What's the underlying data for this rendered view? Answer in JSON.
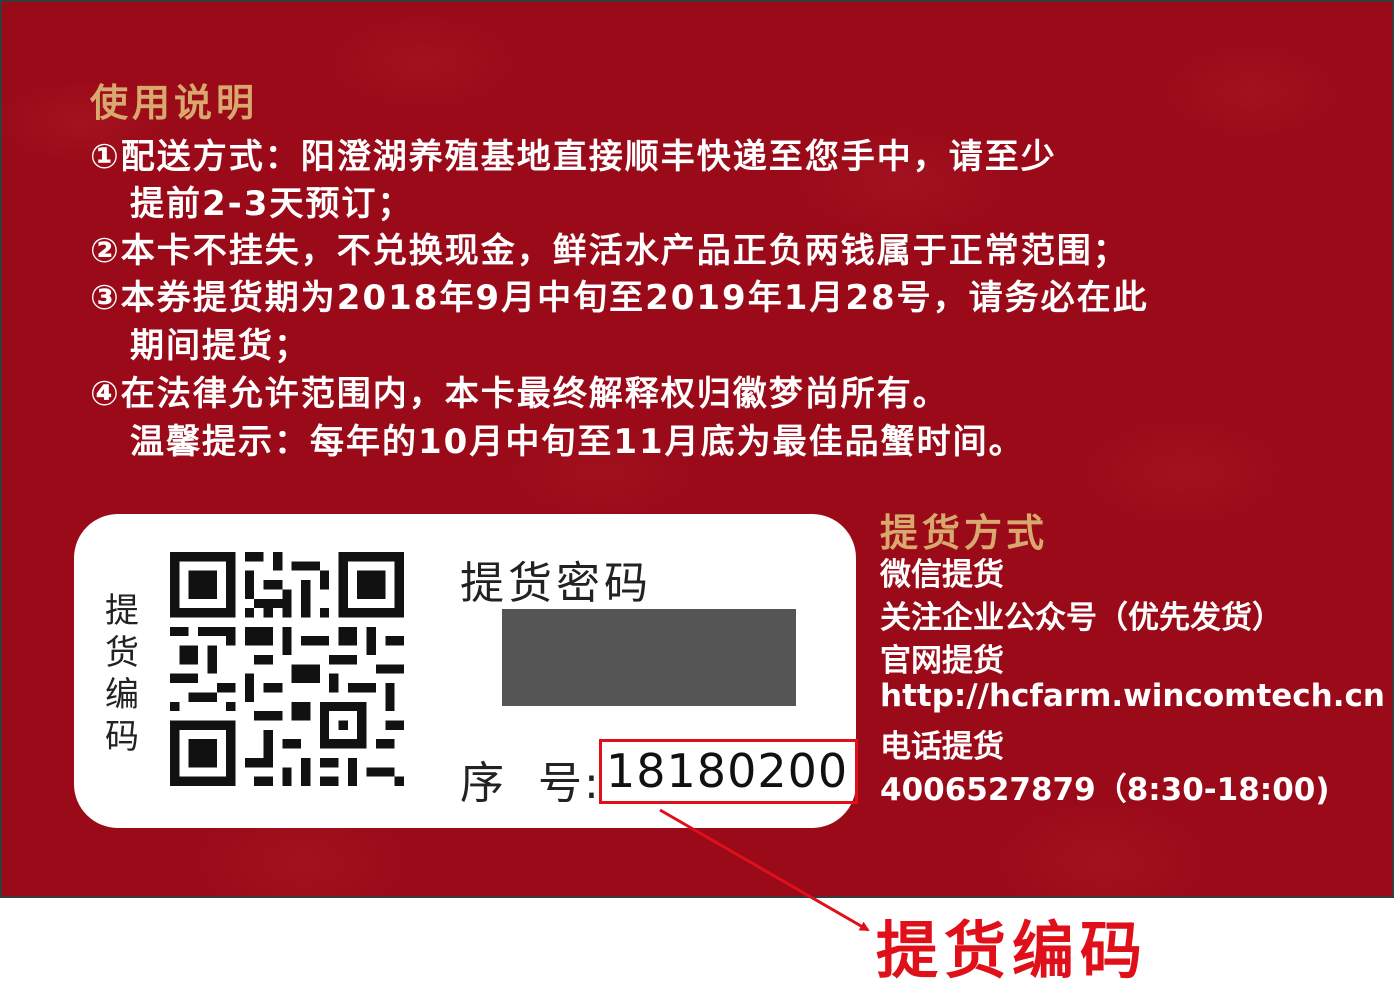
{
  "usage": {
    "title": "使用说明",
    "lines": [
      "①配送方式：阳澄湖养殖基地直接顺丰快递至您手中，请至少",
      "提前2-3天预订；",
      "②本卡不挂失，不兑换现金，鲜活水产品正负两钱属于正常范围；",
      "③本券提货期为2018年9月中旬至2019年1月28号，请务必在此",
      "期间提货；",
      "④在法律允许范围内，本卡最终解释权归徽梦尚所有。",
      "温馨提示：每年的10月中旬至11月底为最佳品蟹时间。"
    ]
  },
  "pickup_methods": {
    "title": "提货方式",
    "lines": [
      "微信提货",
      "关注企业公众号（优先发货）",
      "官网提货",
      "http://hcfarm.wincomtech.cn",
      "电话提货",
      "4006527879（8:30-18:00)"
    ]
  },
  "voucher": {
    "code_label_chars": [
      "提",
      "货",
      "编",
      "码"
    ],
    "password_label": "提货密码",
    "serial_label": "序  号:",
    "serial_value": "18180200"
  },
  "annotation": {
    "label": "提货编码"
  },
  "colors": {
    "card_red": "#9b0a18",
    "title_gold": "#d8a86e",
    "annotation_red": "#e0101a",
    "password_cover": "#555555"
  }
}
